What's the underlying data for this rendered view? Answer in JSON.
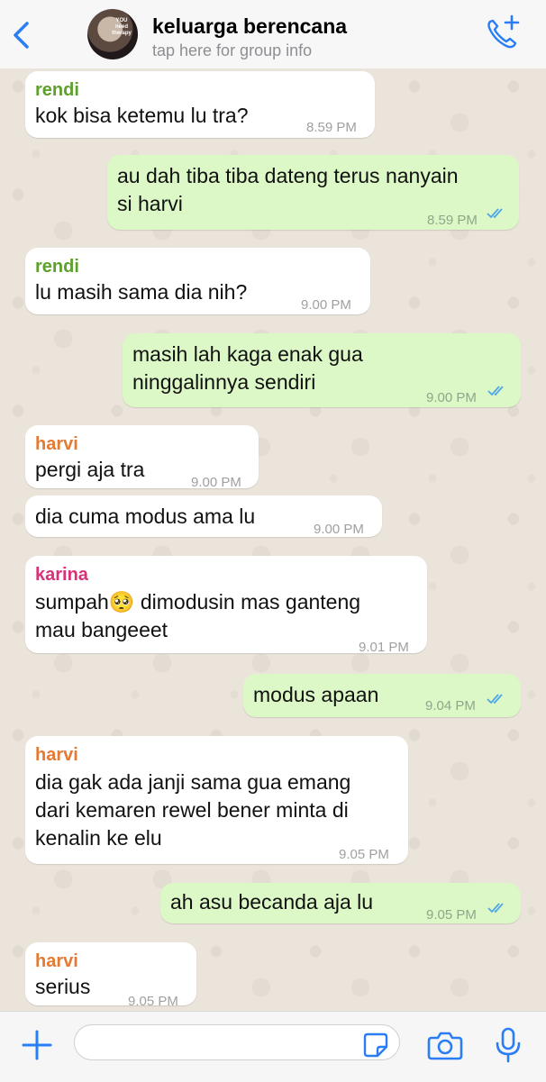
{
  "header": {
    "title": "keluarga berencana",
    "subtitle": "tap here for group info",
    "avatar_text": "YOU need therapy",
    "accent": "#2a7ef5"
  },
  "colors": {
    "incoming_bubble": "#ffffff",
    "outgoing_bubble": "#dcf8c6",
    "sender_rendi": "#5da02c",
    "sender_harvi": "#e47a33",
    "sender_karina": "#d9307a",
    "read_ticks": "#4fa6e8"
  },
  "messages": [
    {
      "sender": "rendi",
      "text": "kok bisa ketemu lu tra?",
      "time": "8.59 PM"
    },
    {
      "text": "au dah tiba tiba dateng terus nanyain\nsi harvi",
      "time": "8.59 PM"
    },
    {
      "sender": "rendi",
      "text": "lu masih sama dia nih?",
      "time": "9.00 PM"
    },
    {
      "text": "masih lah kaga enak gua\nninggalinnya sendiri",
      "time": "9.00 PM"
    },
    {
      "sender": "harvi",
      "text": "pergi aja tra",
      "time": "9.00 PM"
    },
    {
      "text": "dia cuma modus ama lu",
      "time": "9.00 PM"
    },
    {
      "sender": "karina",
      "text": "sumpah🥺 dimodusin mas ganteng\nmau bangeeet",
      "time": "9.01 PM"
    },
    {
      "text": "modus apaan",
      "time": "9.04 PM"
    },
    {
      "sender": "harvi",
      "text": "dia gak ada janji sama gua emang\ndari kemaren rewel bener minta di\nkenalin ke elu",
      "time": "9.05 PM"
    },
    {
      "text": "ah asu becanda aja lu",
      "time": "9.05 PM"
    },
    {
      "sender": "harvi",
      "text": "serius",
      "time": "9.05 PM"
    }
  ],
  "input": {
    "placeholder": ""
  }
}
